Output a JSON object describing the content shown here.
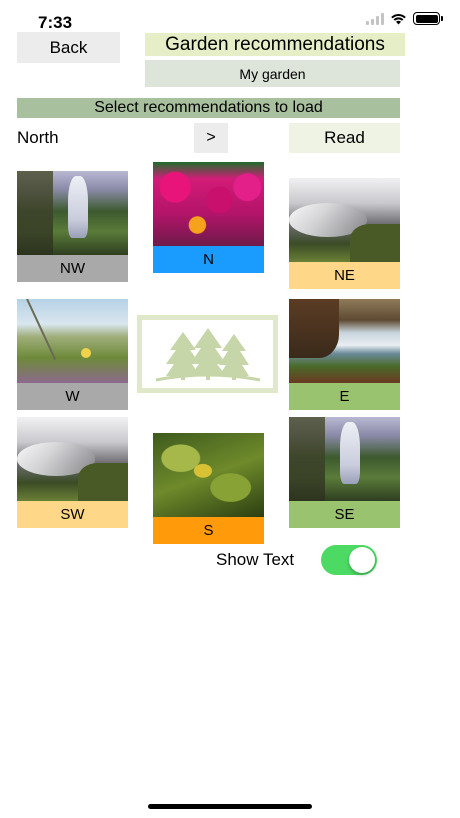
{
  "status_bar": {
    "time": "7:33"
  },
  "nav": {
    "back_label": "Back",
    "title": "Garden recommendations",
    "my_garden_label": "My garden"
  },
  "selector": {
    "banner": "Select recommendations to load",
    "direction": "North",
    "next_label": ">",
    "read_label": "Read"
  },
  "tiles": {
    "nw": {
      "label": "NW",
      "color": "#a9a9a9"
    },
    "n": {
      "label": "N",
      "color": "#1a9cff"
    },
    "ne": {
      "label": "NE",
      "color": "#ffd789"
    },
    "w": {
      "label": "W",
      "color": "#a9a9a9"
    },
    "e": {
      "label": "E",
      "color": "#9ac36f"
    },
    "sw": {
      "label": "SW",
      "color": "#ffd789"
    },
    "s": {
      "label": "S",
      "color": "#ff9a0a"
    },
    "se": {
      "label": "SE",
      "color": "#9ac36f"
    }
  },
  "show_text": {
    "label": "Show Text",
    "enabled": true
  },
  "colors": {
    "toggle_on": "#4cd964",
    "title_bg": "#e5eec7",
    "banner_bg": "#a9c09e"
  }
}
